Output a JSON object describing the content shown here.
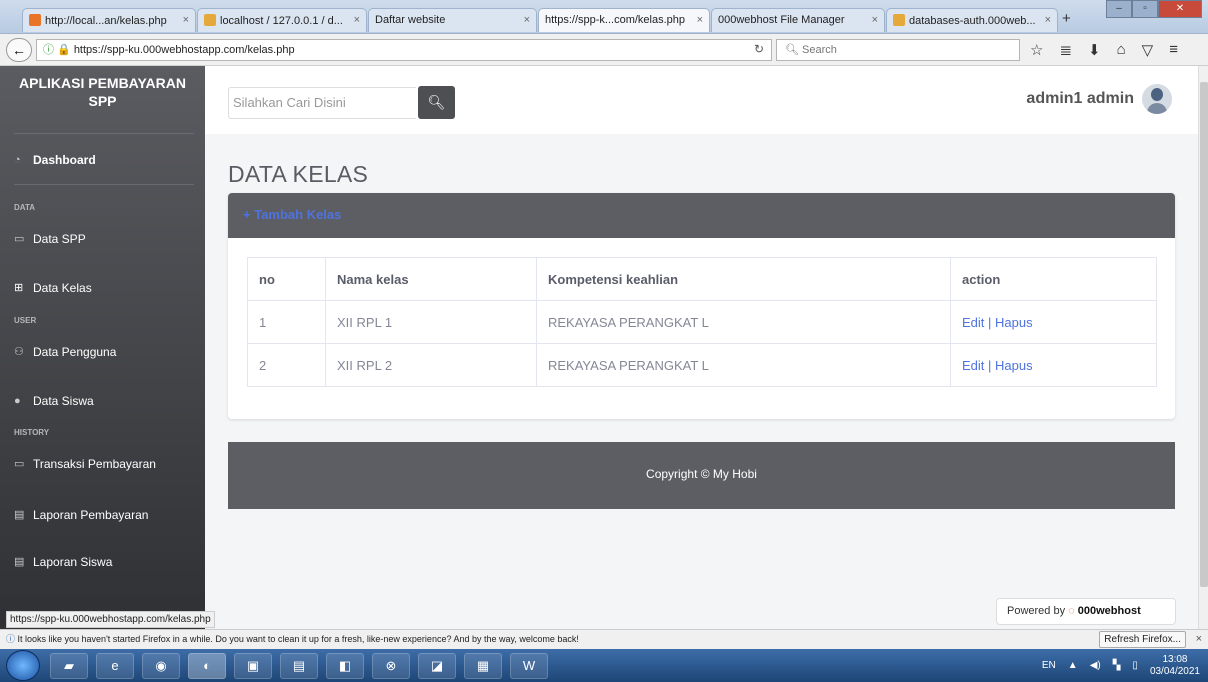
{
  "browser": {
    "tabs": [
      {
        "label": "http://local...an/kelas.php",
        "close": "×"
      },
      {
        "label": "localhost / 127.0.0.1 / d...",
        "close": "×"
      },
      {
        "label": "Daftar website",
        "close": "×"
      },
      {
        "label": "https://spp-k...com/kelas.php",
        "close": "×"
      },
      {
        "label": "000webhost File Manager",
        "close": "×"
      },
      {
        "label": "databases-auth.000web...",
        "close": "×"
      }
    ],
    "new_tab": "+",
    "url": "https://spp-ku.000webhostapp.com/kelas.php",
    "search_placeholder": "Search"
  },
  "sidebar": {
    "brand": "APLIKASI PEMBAYARAN SPP",
    "dashboard": "Dashboard",
    "heading_data": "DATA",
    "data_spp": "Data SPP",
    "data_kelas": "Data Kelas",
    "heading_user": "USER",
    "data_pengguna": "Data Pengguna",
    "data_siswa": "Data Siswa",
    "heading_history": "HISTORY",
    "transaksi": "Transaksi Pembayaran",
    "laporan_pembayaran": "Laporan Pembayaran",
    "laporan_siswa": "Laporan Siswa"
  },
  "topbar": {
    "search_placeholder": "Silahkan Cari Disini",
    "user_name": "admin1 admin"
  },
  "main": {
    "page_title": "DATA KELAS",
    "add_link": "+ Tambah Kelas",
    "columns": [
      "no",
      "Nama kelas",
      "Kompetensi keahlian",
      "action"
    ],
    "rows": [
      {
        "no": "1",
        "nama": "XII RPL 1",
        "kompetensi": "REKAYASA PERANGKAT L",
        "edit": "Edit",
        "sep": " | ",
        "hapus": "Hapus"
      },
      {
        "no": "2",
        "nama": "XII RPL 2",
        "kompetensi": "REKAYASA PERANGKAT L",
        "edit": "Edit",
        "sep": " | ",
        "hapus": "Hapus"
      }
    ],
    "footer": "Copyright © My Hobi"
  },
  "status_url": "https://spp-ku.000webhostapp.com/kelas.php",
  "powered": {
    "prefix": "Powered by",
    "brand": "000webhost"
  },
  "notification": {
    "text": "It looks like you haven't started Firefox in a while. Do you want to clean it up for a fresh, like-new experience? And by the way, welcome back!",
    "button": "Refresh Firefox...",
    "close": "×"
  },
  "taskbar": {
    "lang": "EN",
    "time": "13:08",
    "date": "03/04/2021"
  },
  "colors": {
    "accent": "#4e73df",
    "sidebar": "#3c3d41",
    "card_head": "#5d5e63"
  }
}
